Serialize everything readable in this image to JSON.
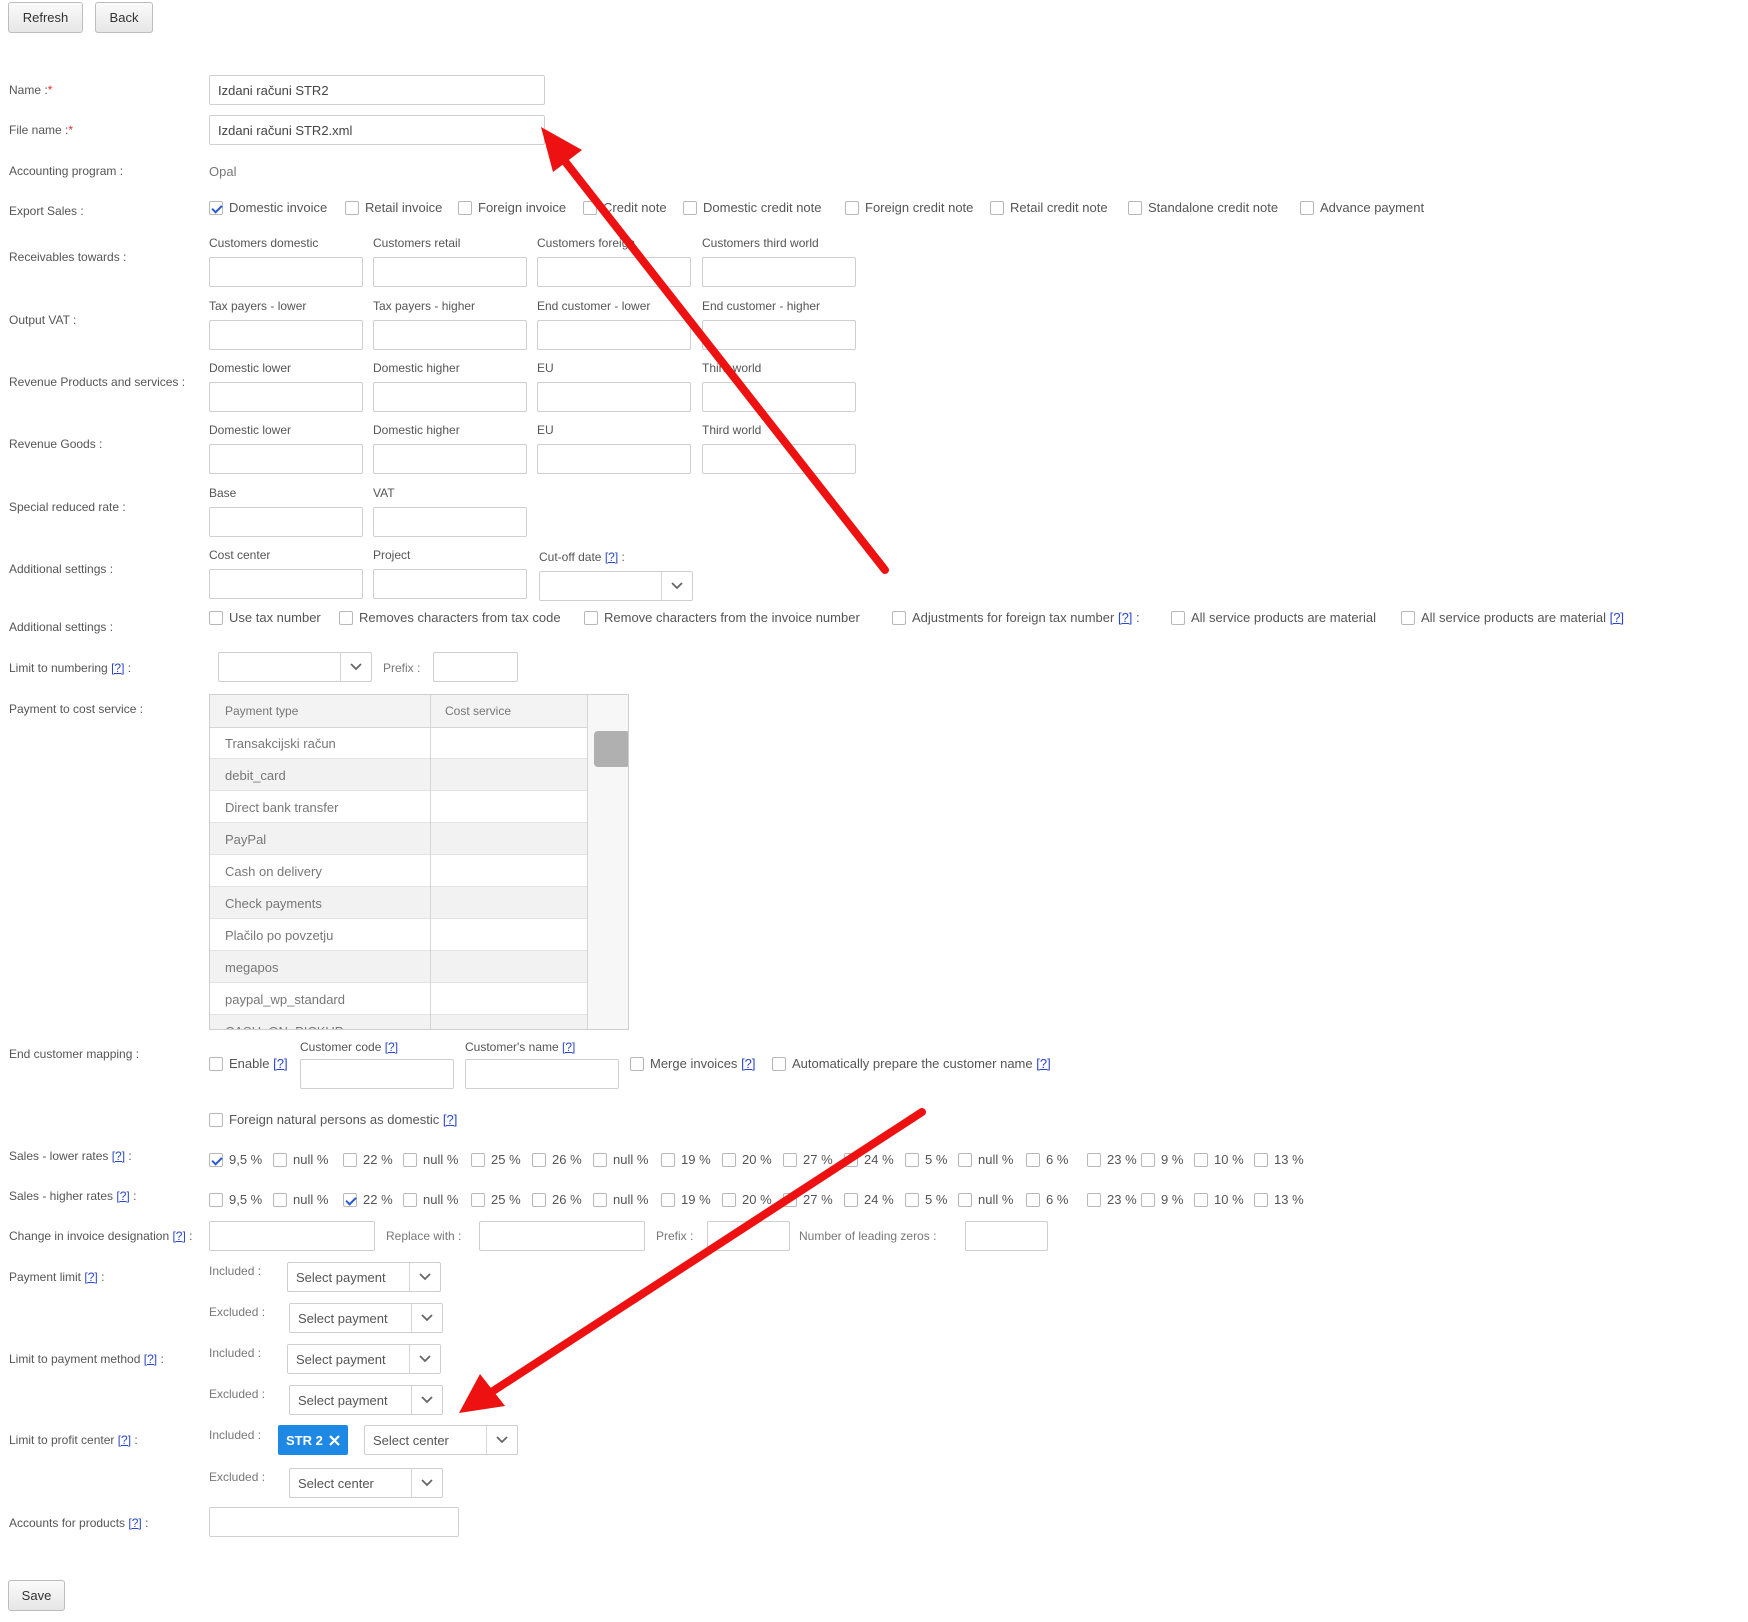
{
  "toolbar": {
    "refresh": "Refresh",
    "back": "Back"
  },
  "form": {
    "name": {
      "label": "Name :",
      "value": "Izdani računi STR2"
    },
    "file_name": {
      "label": "File name :",
      "value": "Izdani računi STR2.xml"
    },
    "required_mark": "*",
    "accounting_program": {
      "label": "Accounting program :",
      "value": "Opal"
    },
    "export_sales": {
      "label": "Export Sales :",
      "options": [
        {
          "label": "Domestic invoice",
          "checked": true
        },
        {
          "label": "Retail invoice",
          "checked": false
        },
        {
          "label": "Foreign invoice",
          "checked": false
        },
        {
          "label": "Credit note",
          "checked": false
        },
        {
          "label": "Domestic credit note",
          "checked": false
        },
        {
          "label": "Foreign credit note",
          "checked": false
        },
        {
          "label": "Retail credit note",
          "checked": false
        },
        {
          "label": "Standalone credit note",
          "checked": false
        },
        {
          "label": "Advance payment",
          "checked": false
        }
      ]
    },
    "receivables": {
      "label": "Receivables towards :",
      "fields": [
        "Customers domestic",
        "Customers retail",
        "Customers foreign",
        "Customers third world"
      ]
    },
    "output_vat": {
      "label": "Output VAT :",
      "fields": [
        "Tax payers - lower",
        "Tax payers - higher",
        "End customer - lower",
        "End customer - higher"
      ]
    },
    "revenue_products": {
      "label": "Revenue Products and services :",
      "fields": [
        "Domestic lower",
        "Domestic higher",
        "EU",
        "Third world"
      ]
    },
    "revenue_goods": {
      "label": "Revenue Goods :",
      "fields": [
        "Domestic lower",
        "Domestic higher",
        "EU",
        "Third world"
      ]
    },
    "special_reduced": {
      "label": "Special reduced rate :",
      "fields": [
        "Base",
        "VAT"
      ]
    },
    "additional_1": {
      "label": "Additional settings :",
      "fields": [
        "Cost center",
        "Project"
      ],
      "cutoff_label": "Cut-off date",
      "cutoff_suffix": ":"
    },
    "additional_2": {
      "label": "Additional settings :",
      "options": [
        {
          "label": "Use tax number",
          "checked": false
        },
        {
          "label": "Removes characters from tax code",
          "checked": false
        },
        {
          "label": "Remove characters from the invoice number",
          "checked": false
        },
        {
          "label": "Adjustments for foreign tax number",
          "checked": false,
          "help": "[?]",
          "suffix": ":"
        },
        {
          "label": "All service products are material",
          "checked": false
        },
        {
          "label": "All service products are material",
          "checked": false,
          "help": "[?]"
        }
      ]
    },
    "limit_numbering": {
      "label": "Limit to numbering",
      "prefix_label": "Prefix :"
    },
    "payment_cost": {
      "label": "Payment to cost service :",
      "columns": [
        "Payment type",
        "Cost service"
      ],
      "rows": [
        "Transakcijski račun",
        "debit_card",
        "Direct bank transfer",
        "PayPal",
        "Cash on delivery",
        "Check payments",
        "Plačilo po povzetju",
        "megapos",
        "paypal_wp_standard",
        "CASH_ON_PICKUP"
      ]
    },
    "end_customer": {
      "label": "End customer mapping :",
      "enable": "Enable",
      "customer_code": "Customer code",
      "customer_name": "Customer's name",
      "merge": "Merge invoices",
      "auto_name": "Automatically prepare the customer name",
      "foreign_natural": "Foreign natural persons as domestic"
    },
    "rates": [
      "9,5 %",
      "null %",
      "22 %",
      "null %",
      "25 %",
      "26 %",
      "null %",
      "19 %",
      "20 %",
      "27 %",
      "24 %",
      "5 %",
      "null %",
      "6 %",
      "23 %",
      "9 %",
      "10 %",
      "13 %"
    ],
    "sales_lower": {
      "label": "Sales - lower rates",
      "checked_index": 0
    },
    "sales_higher": {
      "label": "Sales - higher rates",
      "checked_index": 2
    },
    "change_designation": {
      "label": "Change in invoice designation",
      "replace_with": "Replace with :",
      "prefix": "Prefix :",
      "leading_zeros": "Number of leading zeros :"
    },
    "payment_limit": {
      "label": "Payment limit",
      "included": "Included :",
      "excluded": "Excluded :",
      "placeholder": "Select payment"
    },
    "limit_payment_method": {
      "label": "Limit to payment method",
      "included": "Included :",
      "excluded": "Excluded :",
      "placeholder": "Select payment"
    },
    "limit_profit_center": {
      "label": "Limit to profit center",
      "included": "Included :",
      "excluded": "Excluded :",
      "tag": "STR 2",
      "placeholder": "Select center"
    },
    "accounts_products": {
      "label": "Accounts for products"
    },
    "help": "[?]",
    "colon": ":",
    "save": "Save"
  },
  "colors": {
    "arrow": "#ee1111",
    "tag": "#1e88e5",
    "help_link": "#2a46c8"
  }
}
